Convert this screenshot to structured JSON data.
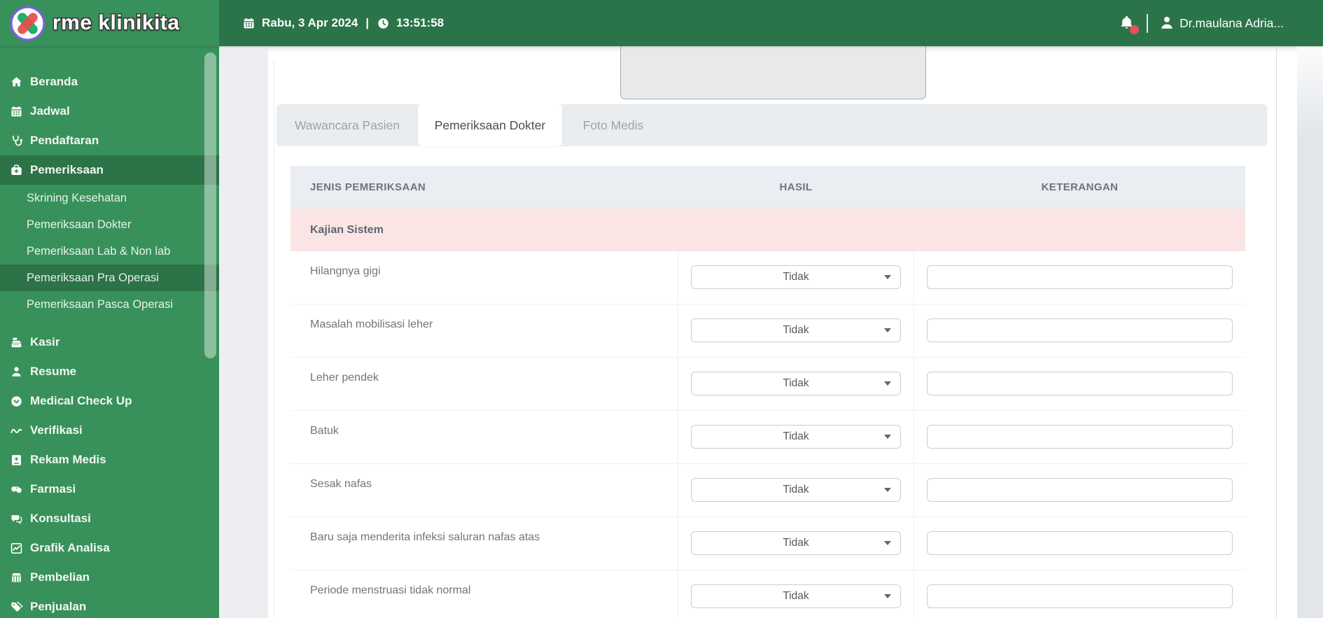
{
  "brand": {
    "name": "rme klinikita"
  },
  "topbar": {
    "date": "Rabu, 3 Apr 2024",
    "separator": "|",
    "time": "13:51:58",
    "user": "Dr.maulana Adria...",
    "has_notification": true
  },
  "sidebar": {
    "items": [
      {
        "label": "Beranda",
        "icon": "home"
      },
      {
        "label": "Jadwal",
        "icon": "calendar"
      },
      {
        "label": "Pendaftaran",
        "icon": "stethoscope"
      },
      {
        "label": "Pemeriksaan",
        "icon": "medical-bag",
        "active": true,
        "children": [
          {
            "label": "Skrining Kesehatan"
          },
          {
            "label": "Pemeriksaan Dokter"
          },
          {
            "label": "Pemeriksaan Lab & Non lab"
          },
          {
            "label": "Pemeriksaan Pra Operasi",
            "active": true
          },
          {
            "label": "Pemeriksaan Pasca Operasi"
          }
        ]
      },
      {
        "label": "Kasir",
        "icon": "cash-register"
      },
      {
        "label": "Resume",
        "icon": "person"
      },
      {
        "label": "Medical Check Up",
        "icon": "circle-chevron"
      },
      {
        "label": "Verifikasi",
        "icon": "wave"
      },
      {
        "label": "Rekam Medis",
        "icon": "book-plus"
      },
      {
        "label": "Farmasi",
        "icon": "pills"
      },
      {
        "label": "Konsultasi",
        "icon": "chat"
      },
      {
        "label": "Grafik Analisa",
        "icon": "chart"
      },
      {
        "label": "Pembelian",
        "icon": "shop"
      },
      {
        "label": "Penjualan",
        "icon": "tags"
      }
    ]
  },
  "tabs": [
    {
      "label": "Wawancara Pasien",
      "active": false
    },
    {
      "label": "Pemeriksaan Dokter",
      "active": true
    },
    {
      "label": "Foto Medis",
      "active": false
    }
  ],
  "table": {
    "headers": [
      "JENIS PEMERIKSAAN",
      "HASIL",
      "KETERANGAN"
    ],
    "section_label": "Kajian Sistem",
    "rows": [
      {
        "label": "Hilangnya gigi",
        "hasil": "Tidak",
        "keterangan": ""
      },
      {
        "label": "Masalah mobilisasi leher",
        "hasil": "Tidak",
        "keterangan": ""
      },
      {
        "label": "Leher pendek",
        "hasil": "Tidak",
        "keterangan": ""
      },
      {
        "label": "Batuk",
        "hasil": "Tidak",
        "keterangan": ""
      },
      {
        "label": "Sesak nafas",
        "hasil": "Tidak",
        "keterangan": ""
      },
      {
        "label": "Baru saja menderita infeksi saluran nafas atas",
        "hasil": "Tidak",
        "keterangan": ""
      },
      {
        "label": "Periode menstruasi tidak normal",
        "hasil": "Tidak",
        "keterangan": ""
      }
    ]
  },
  "colors": {
    "brand_green": "#38915a",
    "topbar_green": "#2b7449",
    "active_item_green": "#2c7347",
    "section_pink": "#fbe5e4",
    "notification_red": "#e8505b",
    "logo_ring_purple": "#7a63d8",
    "table_header_gray": "#eaedf1"
  }
}
